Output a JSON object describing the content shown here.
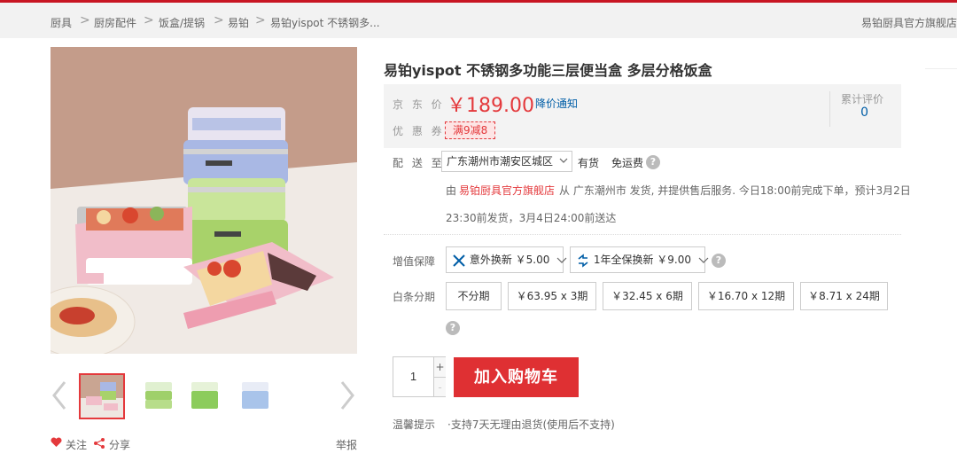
{
  "breadcrumb": {
    "items": [
      "厨具",
      "厨房配件",
      "饭盒/提锅",
      "易铂",
      "易铂yispot 不锈钢多..."
    ],
    "separator": ">",
    "shop_name": "易铂厨具官方旗舰店"
  },
  "gallery": {
    "image_alt": "pink lunch box with food and stacked blue and green lunch boxes",
    "thumbnail_count": 4,
    "selected_index": 0
  },
  "actions": {
    "follow": "关注",
    "share": "分享",
    "report": "举报"
  },
  "product": {
    "title": "易铂yispot 不锈钢多功能三层便当盒 多层分格饭盒",
    "price_label": "京 东 价",
    "price": "￥189.00",
    "price_alert": "降价通知",
    "coupon_label": "优 惠 券",
    "coupon": "满9减8",
    "review_label": "累计评价",
    "review_count": "0"
  },
  "delivery": {
    "label": "配 送 至",
    "address": "广东潮州市潮安区城区",
    "stock": "有货",
    "shipping": "免运费",
    "seller_prefix": "由",
    "seller": "易铂厨具官方旗舰店",
    "line1_rest": "从 广东潮州市 发货, 并提供售后服务. 今日18:00前完成下单，预计3月2日",
    "line2": "23:30前发货，3月4日24:00前送达"
  },
  "value_added": {
    "label": "增值保障",
    "options": [
      "意外换新 ￥5.00",
      "1年全保换新 ￥9.00"
    ]
  },
  "installment": {
    "label": "白条分期",
    "options": [
      "不分期",
      "￥63.95 x 3期",
      "￥32.45 x 6期",
      "￥16.70 x 12期",
      "￥8.71 x 24期"
    ]
  },
  "purchase": {
    "quantity": "1",
    "plus": "+",
    "minus": "-",
    "add_to_cart": "加入购物车"
  },
  "tips": {
    "label": "温馨提示",
    "text": "·支持7天无理由退货(使用后不支持)"
  },
  "colors": {
    "accent_red": "#e4393c",
    "link_blue": "#005ea7",
    "cart_button": "#df3033"
  }
}
